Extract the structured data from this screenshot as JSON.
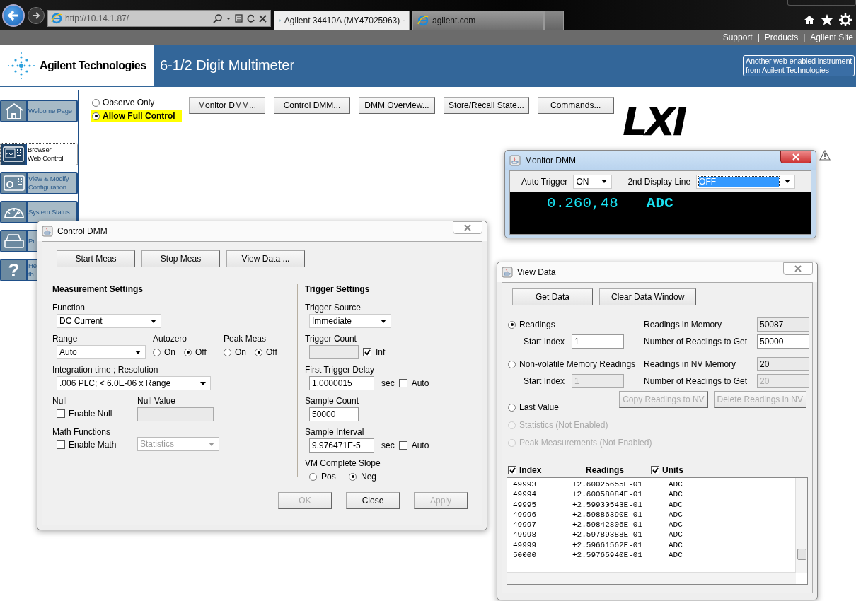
{
  "browser": {
    "address": "http://10.14.1.87/",
    "tabs": [
      {
        "title": "Agilent 34410A (MY47025963)",
        "selected": true
      },
      {
        "title": "agilent.com",
        "selected": false
      }
    ]
  },
  "top_links": [
    {
      "label": "Support",
      "separator": "|"
    },
    {
      "label": "Products",
      "separator": "|"
    },
    {
      "label": "Agilent Site"
    }
  ],
  "header": {
    "brand": "Agilent Technologies",
    "title": "6-1/2 Digit Multimeter",
    "badge": [
      "Another web-enabled instrument",
      "from Agilent Technologies"
    ]
  },
  "sidebar": [
    {
      "kind": "home",
      "lines": [
        "Welcome Page"
      ],
      "selected": false
    },
    {
      "kind": "panel",
      "lines": [
        "Browser",
        "Web Control"
      ],
      "selected": true
    },
    {
      "kind": "config",
      "lines": [
        "View & Modify",
        "Configuration"
      ],
      "selected": false
    },
    {
      "kind": "gauge",
      "lines": [
        "System Status"
      ],
      "selected": false
    },
    {
      "kind": "printer",
      "lines": [
        "Pr"
      ],
      "selected": false
    },
    {
      "kind": "help",
      "glyph": "?",
      "lines": [
        "He",
        "th"
      ],
      "selected": false
    }
  ],
  "access": [
    {
      "label": "Observe Only",
      "selected": false
    },
    {
      "label": "Allow Full Control",
      "selected": true
    }
  ],
  "nav_buttons": [
    "Monitor DMM...",
    "Control DMM...",
    "DMM Overview...",
    "Store/Recall State...",
    "Commands..."
  ],
  "logo": "LXI",
  "monitor_dmm": {
    "title": "Monitor DMM",
    "auto_trigger": {
      "label": "Auto Trigger",
      "value": "ON"
    },
    "display_line": {
      "label": "2nd Display Line",
      "value": "OFF"
    },
    "reading": "0.260,48",
    "unit": "ADC"
  },
  "control_dmm": {
    "title": "Control DMM",
    "actions": [
      "Start Meas",
      "Stop Meas",
      "View Data ..."
    ],
    "measurement": {
      "heading": "Measurement Settings",
      "function": {
        "label": "Function",
        "value": "DC Current"
      },
      "range": {
        "label": "Range",
        "value": "Auto"
      },
      "autozero": {
        "label": "Autozero",
        "options": [
          {
            "label": "On",
            "selected": false
          },
          {
            "label": "Off",
            "selected": true
          }
        ]
      },
      "peak_meas": {
        "label": "Peak Meas",
        "options": [
          {
            "label": "On",
            "selected": false
          },
          {
            "label": "Off",
            "selected": true
          }
        ]
      },
      "integration": {
        "label": "Integration time ; Resolution",
        "value": ".006 PLC; < 6.0E-06 x Range"
      },
      "null": {
        "label": "Null",
        "checkbox": {
          "label": "Enable Null",
          "checked": false
        },
        "value_label": "Null Value"
      },
      "math": {
        "label": "Math Functions",
        "checkbox": {
          "label": "Enable Math",
          "checked": false
        },
        "value": "Statistics"
      }
    },
    "trigger": {
      "heading": "Trigger Settings",
      "source": {
        "label": "Trigger Source",
        "value": "Immediate"
      },
      "count": {
        "label": "Trigger Count",
        "inf": {
          "label": "Inf",
          "checked": true
        }
      },
      "delay": {
        "label": "First Trigger Delay",
        "value": "1.0000015",
        "unit": "sec",
        "auto": {
          "label": "Auto",
          "checked": false
        }
      },
      "sample_count": {
        "label": "Sample Count",
        "value": "50000"
      },
      "sample_interval": {
        "label": "Sample Interval",
        "value": "9.976471E-5",
        "unit": "sec",
        "auto": {
          "label": "Auto",
          "checked": false
        }
      },
      "slope": {
        "label": "VM Complete Slope",
        "options": [
          {
            "label": "Pos",
            "selected": false
          },
          {
            "label": "Neg",
            "selected": true
          }
        ]
      }
    },
    "footer": [
      {
        "label": "OK",
        "disabled": true
      },
      {
        "label": "Close",
        "disabled": false
      },
      {
        "label": "Apply",
        "disabled": true
      }
    ]
  },
  "view_data": {
    "title": "View Data",
    "actions": [
      "Get Data",
      "Clear Data Window"
    ],
    "readings": {
      "label": "Readings",
      "selected": true,
      "start_label": "Start Index",
      "start_value": "1",
      "memory_label": "Readings in Memory",
      "memory_value": "50087",
      "get_label": "Number of Readings to Get",
      "get_value": "50000"
    },
    "nv": {
      "label": "Non-volatile Memory Readings",
      "selected": false,
      "start_label": "Start Index",
      "start_value": "1",
      "memory_label": "Readings in NV Memory",
      "memory_value": "20",
      "get_label": "Number of Readings to Get",
      "get_value": "20",
      "disabled": true,
      "buttons": [
        {
          "label": "Copy Readings to NV",
          "disabled": true
        },
        {
          "label": "Delete Readings in NV",
          "disabled": true
        }
      ]
    },
    "other_sources": [
      {
        "label": "Last Value",
        "selected": false,
        "disabled": false
      },
      {
        "label": "Statistics (Not Enabled)",
        "selected": false,
        "disabled": true
      },
      {
        "label": "Peak Measurements (Not Enabled)",
        "selected": false,
        "disabled": true
      }
    ],
    "columns": [
      {
        "label": "Index",
        "kind": "checkbox",
        "checked": true
      },
      {
        "label": "Readings",
        "kind": "text"
      },
      {
        "label": "Units",
        "kind": "checkbox",
        "checked": true
      }
    ],
    "rows": [
      {
        "index": "49993",
        "reading": "+2.60025655E-01",
        "unit": "ADC"
      },
      {
        "index": "49994",
        "reading": "+2.60058084E-01",
        "unit": "ADC"
      },
      {
        "index": "49995",
        "reading": "+2.59930543E-01",
        "unit": "ADC"
      },
      {
        "index": "49996",
        "reading": "+2.59886390E-01",
        "unit": "ADC"
      },
      {
        "index": "49997",
        "reading": "+2.59842806E-01",
        "unit": "ADC"
      },
      {
        "index": "49998",
        "reading": "+2.59789388E-01",
        "unit": "ADC"
      },
      {
        "index": "49999",
        "reading": "+2.59661562E-01",
        "unit": "ADC"
      },
      {
        "index": "50000",
        "reading": "+2.59765940E-01",
        "unit": "ADC"
      }
    ]
  }
}
